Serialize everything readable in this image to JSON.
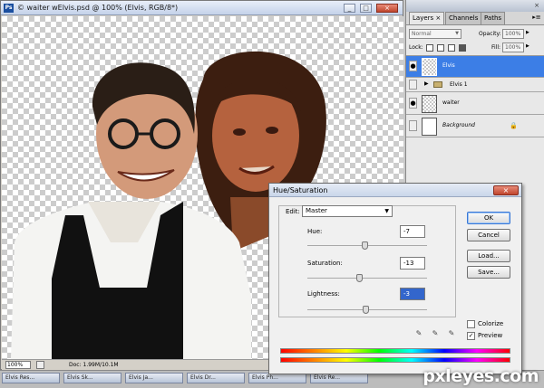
{
  "document": {
    "title": "© waiter wElvis.psd @ 100% (Elvis, RGB/8*)",
    "app_icon": "Ps",
    "zoom": "100%",
    "doc_info": "Doc: 1.99M/10.1M"
  },
  "layers_panel": {
    "tabs": [
      {
        "label": "Layers ×",
        "active": true
      },
      {
        "label": "Channels",
        "active": false
      },
      {
        "label": "Paths",
        "active": false
      }
    ],
    "blend_mode": "Normal",
    "opacity_label": "Opacity:",
    "opacity_value": "100%",
    "lock_label": "Lock:",
    "fill_label": "Fill:",
    "fill_value": "100%",
    "layers": [
      {
        "name": "Elvis",
        "visible": true,
        "selected": true
      },
      {
        "name": "Elvis 1",
        "visible": false,
        "selected": false,
        "is_group": true
      },
      {
        "name": "waiter",
        "visible": true,
        "selected": false
      },
      {
        "name": "Background",
        "visible": false,
        "selected": false,
        "locked": true
      }
    ]
  },
  "hue_saturation": {
    "title": "Hue/Saturation",
    "edit_label": "Edit:",
    "edit_value": "Master",
    "hue_label": "Hue:",
    "hue_value": "-7",
    "hue_level": -7,
    "saturation_label": "Saturation:",
    "saturation_value": "-13",
    "saturation_level": -13,
    "lightness_label": "Lightness:",
    "lightness_value": "-3",
    "lightness_level": -3,
    "ok_label": "OK",
    "cancel_label": "Cancel",
    "load_label": "Load...",
    "save_label": "Save...",
    "colorize_label": "Colorize",
    "colorize_checked": false,
    "preview_label": "Preview",
    "preview_checked": true
  },
  "taskbar": {
    "items": [
      "Elvis Res...",
      "Elvis Sk...",
      "Elvis Ja...",
      "Elvis Dr...",
      "Elvis Ph...",
      "Elvis Re..."
    ]
  },
  "watermark": "pxleyes.com",
  "colors": {
    "selection_blue": "#3c7ee6",
    "dialog_bg": "#f0f0f0",
    "close_red": "#c0452d"
  }
}
